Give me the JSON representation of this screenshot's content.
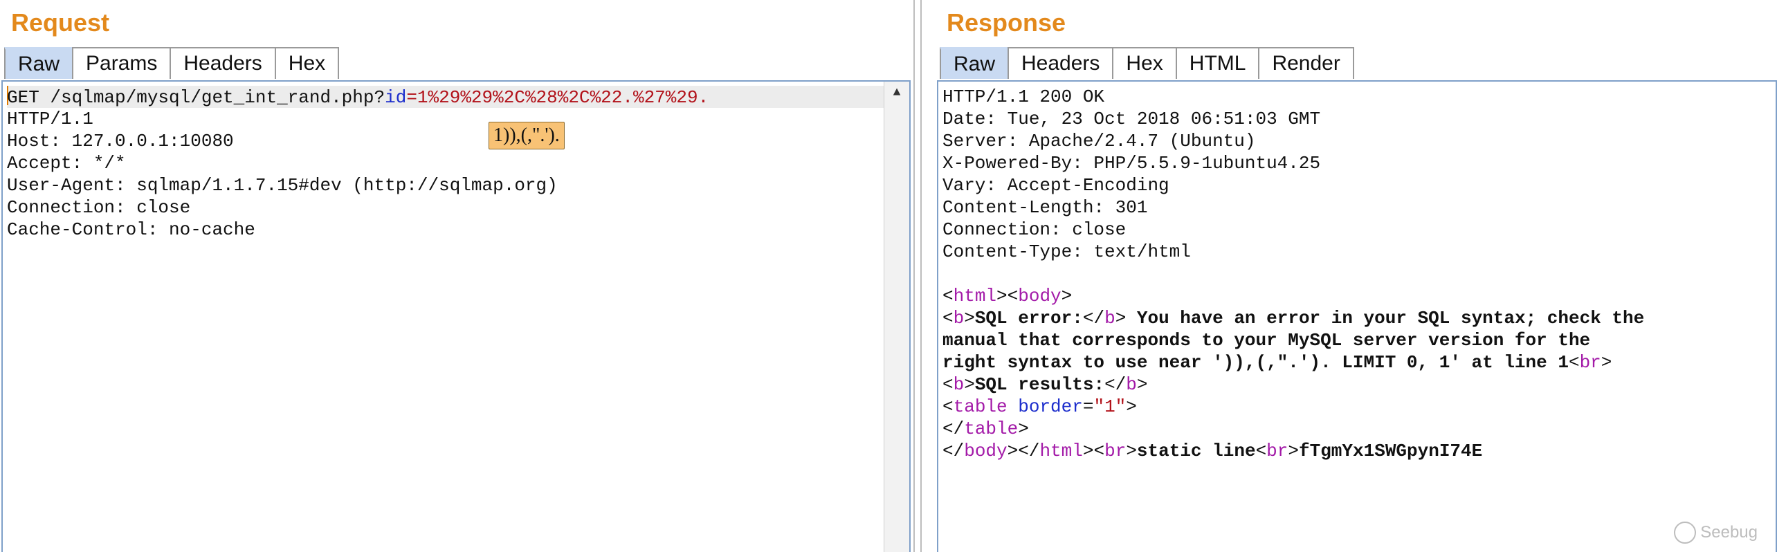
{
  "request": {
    "title": "Request",
    "tabs": [
      "Raw",
      "Params",
      "Headers",
      "Hex"
    ],
    "active_tab": "Raw",
    "line1": {
      "prefix": "GET /sqlmap/mysql/get_int_rand.php?",
      "param_name": "id",
      "eq": "=",
      "param_value": "1%29%29%2C%28%2C%22.%27%29."
    },
    "lines": [
      "HTTP/1.1",
      "Host: 127.0.0.1:10080",
      "Accept: */*",
      "User-Agent: sqlmap/1.1.7.15#dev (http://sqlmap.org)",
      "Connection: close",
      "Cache-Control: no-cache"
    ],
    "tooltip": "1)),(,\".')."
  },
  "response": {
    "title": "Response",
    "tabs": [
      "Raw",
      "Headers",
      "Hex",
      "HTML",
      "Render"
    ],
    "active_tab": "Raw",
    "headers": [
      "HTTP/1.1 200 OK",
      "Date: Tue, 23 Oct 2018 06:51:03 GMT",
      "Server: Apache/2.4.7 (Ubuntu)",
      "X-Powered-By: PHP/5.5.9-1ubuntu4.25",
      "Vary: Accept-Encoding",
      "Content-Length: 301",
      "Connection: close",
      "Content-Type: text/html"
    ],
    "body": {
      "tag_html": "html",
      "tag_body": "body",
      "tag_b": "b",
      "tag_br": "br",
      "tag_table": "table",
      "attr_border": "border",
      "attr_border_value": "\"1\"",
      "sql_error_label": "SQL error:",
      "error_text_1": " You have an error in your SQL syntax; check the",
      "error_text_2": "manual that corresponds to your MySQL server version for the",
      "error_text_3": "right syntax to use near ')),(,\".'). LIMIT 0, 1' at line 1",
      "sql_results_label": "SQL results:",
      "static_line": "static line",
      "token": "fTgmYx1SWGpynI74E"
    }
  },
  "watermark": "Seebug",
  "colors": {
    "title_orange": "#e3891c",
    "tab_active": "#c9daf2",
    "tag_purple": "#a31aa8",
    "attr_blue": "#1c2dcc",
    "value_red": "#b2121a"
  }
}
